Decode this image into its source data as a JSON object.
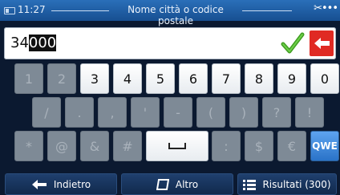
{
  "status_bar": {
    "time": "11:27",
    "title": "Nome città o codice postale"
  },
  "input": {
    "typed": "34",
    "selected": "000"
  },
  "keyboard": {
    "row1": [
      {
        "label": "1",
        "enabled": false
      },
      {
        "label": "2",
        "enabled": false
      },
      {
        "label": "3",
        "enabled": true
      },
      {
        "label": "4",
        "enabled": true
      },
      {
        "label": "5",
        "enabled": true
      },
      {
        "label": "6",
        "enabled": true
      },
      {
        "label": "7",
        "enabled": true
      },
      {
        "label": "8",
        "enabled": true
      },
      {
        "label": "9",
        "enabled": true
      },
      {
        "label": "0",
        "enabled": true
      }
    ],
    "row2": [
      {
        "label": "/",
        "enabled": false
      },
      {
        "label": ".",
        "enabled": false
      },
      {
        "label": ",",
        "enabled": false
      },
      {
        "label": "'",
        "enabled": false
      },
      {
        "label": "-",
        "enabled": false
      },
      {
        "label": "(",
        "enabled": false
      },
      {
        "label": ")",
        "enabled": false
      },
      {
        "label": "?",
        "enabled": false
      },
      {
        "label": "!",
        "enabled": false
      }
    ],
    "row3": [
      {
        "label": "*",
        "enabled": false
      },
      {
        "label": "@",
        "enabled": false
      },
      {
        "label": "&",
        "enabled": false
      },
      {
        "label": "#",
        "enabled": false
      },
      {
        "label": "space",
        "enabled": true
      },
      {
        "label": ":",
        "enabled": false
      },
      {
        "label": "$",
        "enabled": false
      },
      {
        "label": "€",
        "enabled": false
      },
      {
        "label": "QWE",
        "enabled": true
      }
    ]
  },
  "bottom": {
    "back_label": "Indietro",
    "other_label": "Altro",
    "results_label": "Risultati (300)"
  },
  "colors": {
    "accent": "#2a73c8",
    "backspace": "#e02a23",
    "check": "#4caf2a"
  }
}
